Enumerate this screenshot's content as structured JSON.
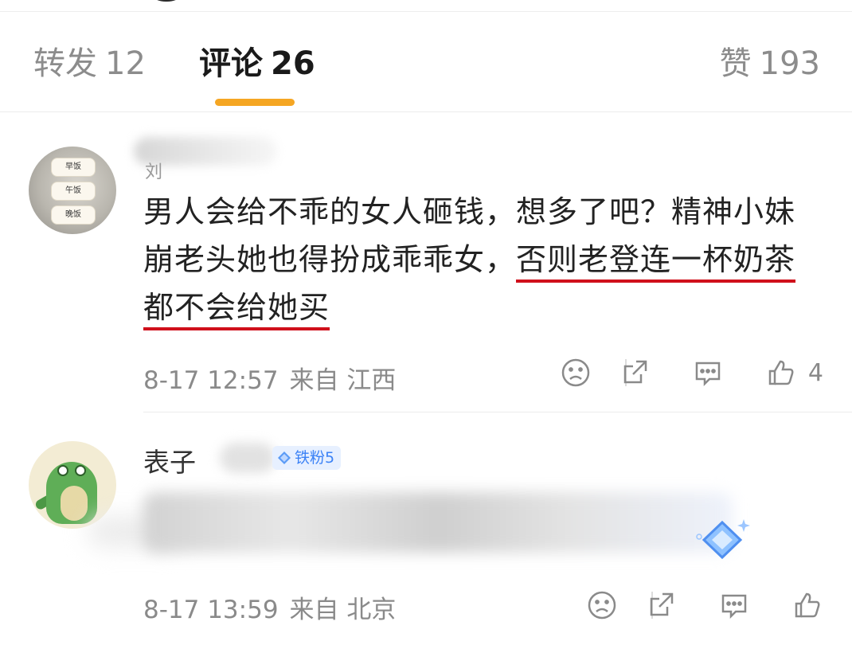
{
  "tabs": {
    "repost": {
      "label": "转发",
      "count": "12"
    },
    "comments": {
      "label": "评论",
      "count": "26"
    },
    "likes": {
      "label": "赞",
      "count": "193"
    }
  },
  "comments": [
    {
      "avatar_labels": [
        "早饭",
        "午饭",
        "晚饭"
      ],
      "name_fragment": "刘",
      "text_before": "男人会给不乖的女人砸钱，想多了吧？精神小妹崩老头她也得扮成乖乖女，",
      "text_highlight": "否则老登连一杯奶茶都不会给她买",
      "date": "8-17 12:57",
      "source": "来自 江西",
      "likes": "4"
    },
    {
      "username": "表子",
      "badge": "铁粉5",
      "date": "8-17 13:59",
      "source": "来自 北京"
    }
  ],
  "icons": [
    "sad-face-icon",
    "share-icon",
    "comment-icon",
    "thumbs-up-icon",
    "diamond-icon"
  ],
  "colors": {
    "accent": "#f5a623",
    "highlight": "#d0101b",
    "badge": "#3b82f6"
  }
}
